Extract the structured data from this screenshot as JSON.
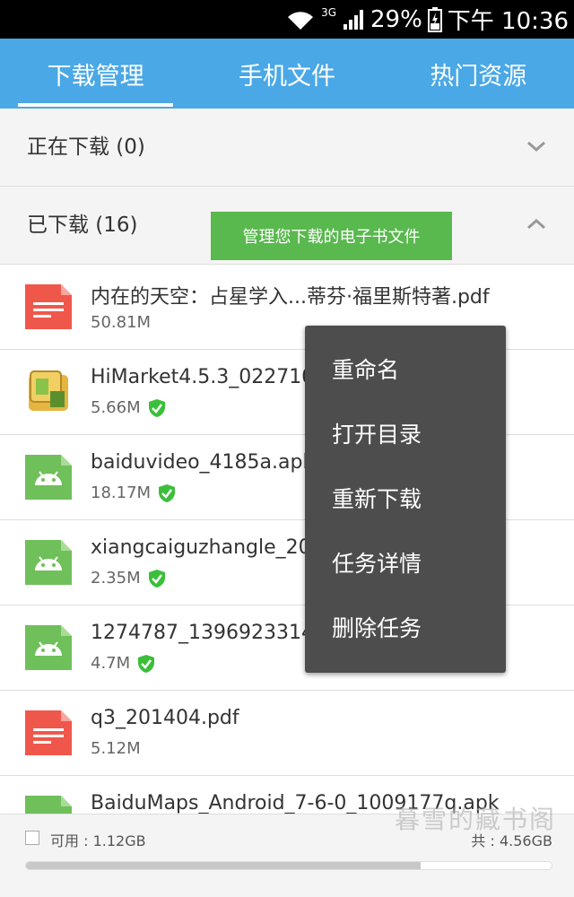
{
  "status_bar": {
    "network": "3G",
    "battery": "29%",
    "time": "下午 10:36"
  },
  "tabs": [
    {
      "label": "下载管理",
      "active": true
    },
    {
      "label": "手机文件",
      "active": false
    },
    {
      "label": "热门资源",
      "active": false
    }
  ],
  "downloading_section": {
    "label": "正在下载 (0)"
  },
  "downloaded_section": {
    "label": "已下载 (16)"
  },
  "tooltip": "管理您下载的电子书文件",
  "files": [
    {
      "name": "内在的天空：占星学入...蒂芬·福里斯特著.pdf",
      "size": "50.81M",
      "icon": "pdf-icon",
      "verified": false
    },
    {
      "name": "HiMarket4.5.3_022710502_27.apk",
      "size": "5.66M",
      "icon": "himarket-app-icon",
      "verified": true
    },
    {
      "name": "baiduvideo_4185a.apk",
      "size": "18.17M",
      "icon": "android-icon",
      "verified": true
    },
    {
      "name": "xiangcaiguzhangle_20140702.apk",
      "size": "2.35M",
      "icon": "android-icon",
      "verified": true
    },
    {
      "name": "1274787_1396923314.apk",
      "size": "4.7M",
      "icon": "android-icon",
      "verified": true
    },
    {
      "name": "q3_201404.pdf",
      "size": "5.12M",
      "icon": "pdf-icon",
      "verified": false
    },
    {
      "name": "BaiduMaps_Android_7-6-0_1009177q.apk",
      "size": "",
      "icon": "android-icon",
      "verified": false
    }
  ],
  "context_menu": [
    "重命名",
    "打开目录",
    "重新下载",
    "任务详情",
    "删除任务"
  ],
  "footer": {
    "available": "可用 : 1.12GB",
    "total": "共 : 4.56GB",
    "used_fraction": 0.75
  },
  "watermark": "暮雪的藏书阁",
  "colors": {
    "header_blue": "#4aa8e6",
    "tooltip_green": "#59b84e",
    "pdf_red": "#f0574b",
    "android_green": "#6fc05a",
    "check_green": "#3bbf3b",
    "menu_bg": "#4d4d4d"
  }
}
